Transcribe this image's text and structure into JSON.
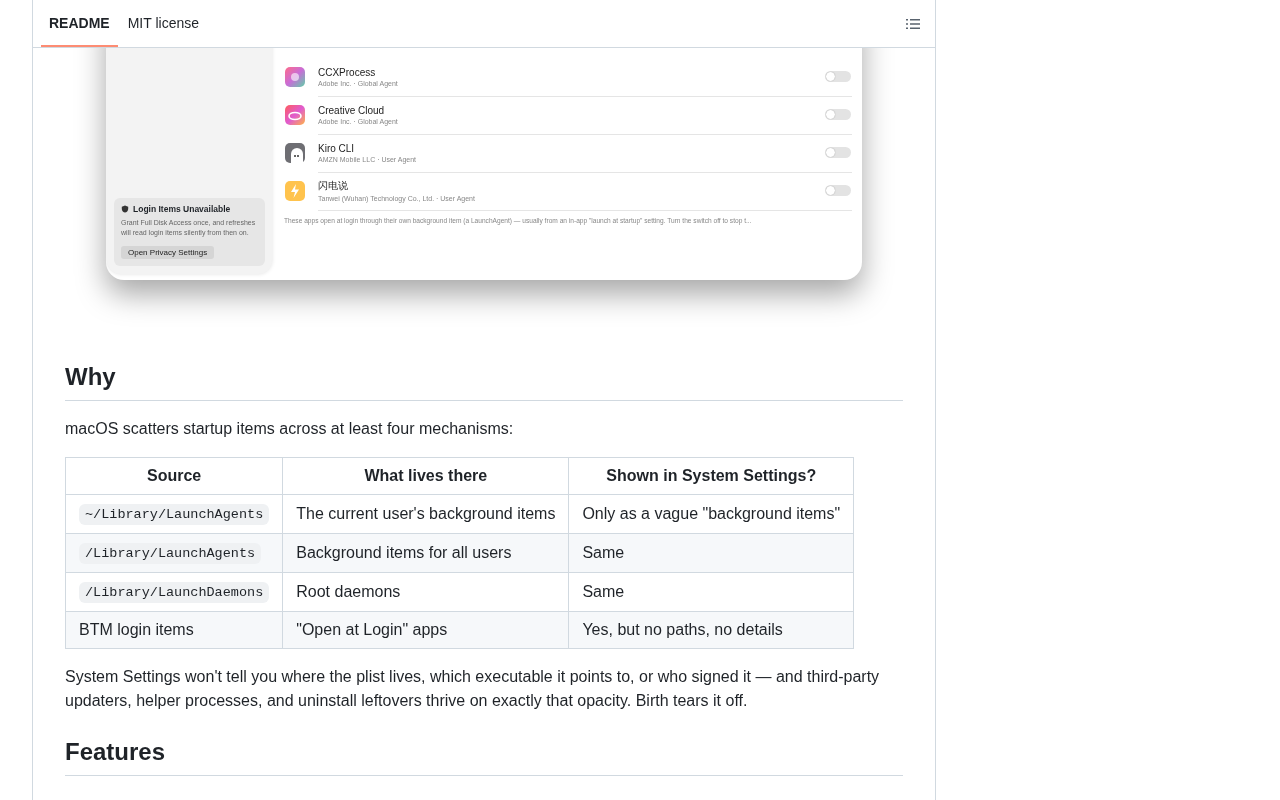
{
  "tabs": [
    {
      "label": "README",
      "selected": true
    },
    {
      "label": "MIT license",
      "selected": false
    }
  ],
  "screenshot": {
    "sidebar_card": {
      "title": "Login Items Unavailable",
      "text": "Grant Full Disk Access once, and refreshes will read login items silently from then on.",
      "button": "Open Privacy Settings"
    },
    "items": [
      {
        "name": "CCXProcess",
        "detail": "Adobe Inc. · Global Agent",
        "kind": "ccx",
        "on": false
      },
      {
        "name": "Creative Cloud",
        "detail": "Adobe Inc. · Global Agent",
        "kind": "cc",
        "on": false
      },
      {
        "name": "Kiro CLI",
        "detail": "AMZN Mobile LLC · User Agent",
        "kind": "ghost",
        "on": false
      },
      {
        "name": "闪电说",
        "detail": "Tanwei (Wuhan) Technology Co., Ltd. · User Agent",
        "kind": "bolt",
        "on": false
      }
    ],
    "footnote": "These apps open at login through their own background item (a LaunchAgent) — usually from an in-app \"launch at startup\" setting. Turn the switch off to stop t..."
  },
  "sections": [
    {
      "heading": "Why",
      "intro": "macOS scatters startup items across at least four mechanisms:",
      "table": {
        "columns": [
          "Source",
          "What lives there",
          "Shown in System Settings?"
        ],
        "rows": [
          [
            {
              "kind": "code",
              "text": "~/Library/LaunchAgents"
            },
            {
              "kind": "text",
              "text": "The current user's background items"
            },
            {
              "kind": "text",
              "text": "Only as a vague \"background items\""
            }
          ],
          [
            {
              "kind": "code",
              "text": "/Library/LaunchAgents"
            },
            {
              "kind": "text",
              "text": "Background items for all users"
            },
            {
              "kind": "text",
              "text": "Same"
            }
          ],
          [
            {
              "kind": "code",
              "text": "/Library/LaunchDaemons"
            },
            {
              "kind": "text",
              "text": "Root daemons"
            },
            {
              "kind": "text",
              "text": "Same"
            }
          ],
          [
            {
              "kind": "text",
              "text": "BTM login items"
            },
            {
              "kind": "text",
              "text": "\"Open at Login\" apps"
            },
            {
              "kind": "text",
              "text": "Yes, but no paths, no details"
            }
          ]
        ]
      },
      "outro": "System Settings won't tell you where the plist lives, which executable it points to, or who signed it — and third-party updaters, helper processes, and uninstall leftovers thrive on exactly that opacity. Birth tears it off."
    },
    {
      "heading": "Features"
    }
  ]
}
